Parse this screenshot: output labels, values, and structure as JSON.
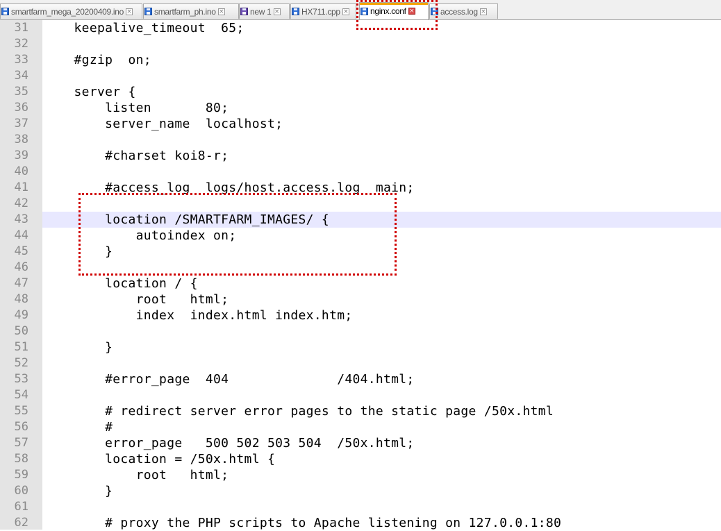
{
  "tabs": [
    {
      "label": "smartfarm_mega_20200409.ino",
      "icon": "save-disk-icon",
      "active": false
    },
    {
      "label": "smartfarm_ph.ino",
      "icon": "save-disk-icon",
      "active": false
    },
    {
      "label": "new 1",
      "icon": "save-disk-icon",
      "active": false
    },
    {
      "label": "HX711.cpp",
      "icon": "save-disk-icon",
      "active": false
    },
    {
      "label": "nginx.conf",
      "icon": "save-disk-icon",
      "active": true
    },
    {
      "label": "access.log",
      "icon": "save-disk-icon",
      "active": false
    }
  ],
  "close_glyph": "×",
  "current_line": 43,
  "colors": {
    "current_line": "#e8e8ff",
    "annotation": "#d00000",
    "active_tab_accent": "#f4a300"
  },
  "lines": [
    {
      "n": "31",
      "text": "    keepalive_timeout  65;"
    },
    {
      "n": "32",
      "text": ""
    },
    {
      "n": "33",
      "text": "    #gzip  on;"
    },
    {
      "n": "34",
      "text": ""
    },
    {
      "n": "35",
      "text": "    server {"
    },
    {
      "n": "36",
      "text": "        listen       80;"
    },
    {
      "n": "37",
      "text": "        server_name  localhost;"
    },
    {
      "n": "38",
      "text": ""
    },
    {
      "n": "39",
      "text": "        #charset koi8-r;"
    },
    {
      "n": "40",
      "text": ""
    },
    {
      "n": "41",
      "text": "        #access_log  logs/host.access.log  main;"
    },
    {
      "n": "42",
      "text": ""
    },
    {
      "n": "43",
      "text": "        location /SMARTFARM_IMAGES/ {"
    },
    {
      "n": "44",
      "text": "            autoindex on;"
    },
    {
      "n": "45",
      "text": "        }"
    },
    {
      "n": "46",
      "text": ""
    },
    {
      "n": "47",
      "text": "        location / {"
    },
    {
      "n": "48",
      "text": "            root   html;"
    },
    {
      "n": "49",
      "text": "            index  index.html index.htm;"
    },
    {
      "n": "50",
      "text": ""
    },
    {
      "n": "51",
      "text": "        }"
    },
    {
      "n": "52",
      "text": ""
    },
    {
      "n": "53",
      "text": "        #error_page  404              /404.html;"
    },
    {
      "n": "54",
      "text": ""
    },
    {
      "n": "55",
      "text": "        # redirect server error pages to the static page /50x.html"
    },
    {
      "n": "56",
      "text": "        #"
    },
    {
      "n": "57",
      "text": "        error_page   500 502 503 504  /50x.html;"
    },
    {
      "n": "58",
      "text": "        location = /50x.html {"
    },
    {
      "n": "59",
      "text": "            root   html;"
    },
    {
      "n": "60",
      "text": "        }"
    },
    {
      "n": "61",
      "text": ""
    },
    {
      "n": "62",
      "text": "        # proxy the PHP scripts to Apache listening on 127.0.0.1:80"
    }
  ]
}
